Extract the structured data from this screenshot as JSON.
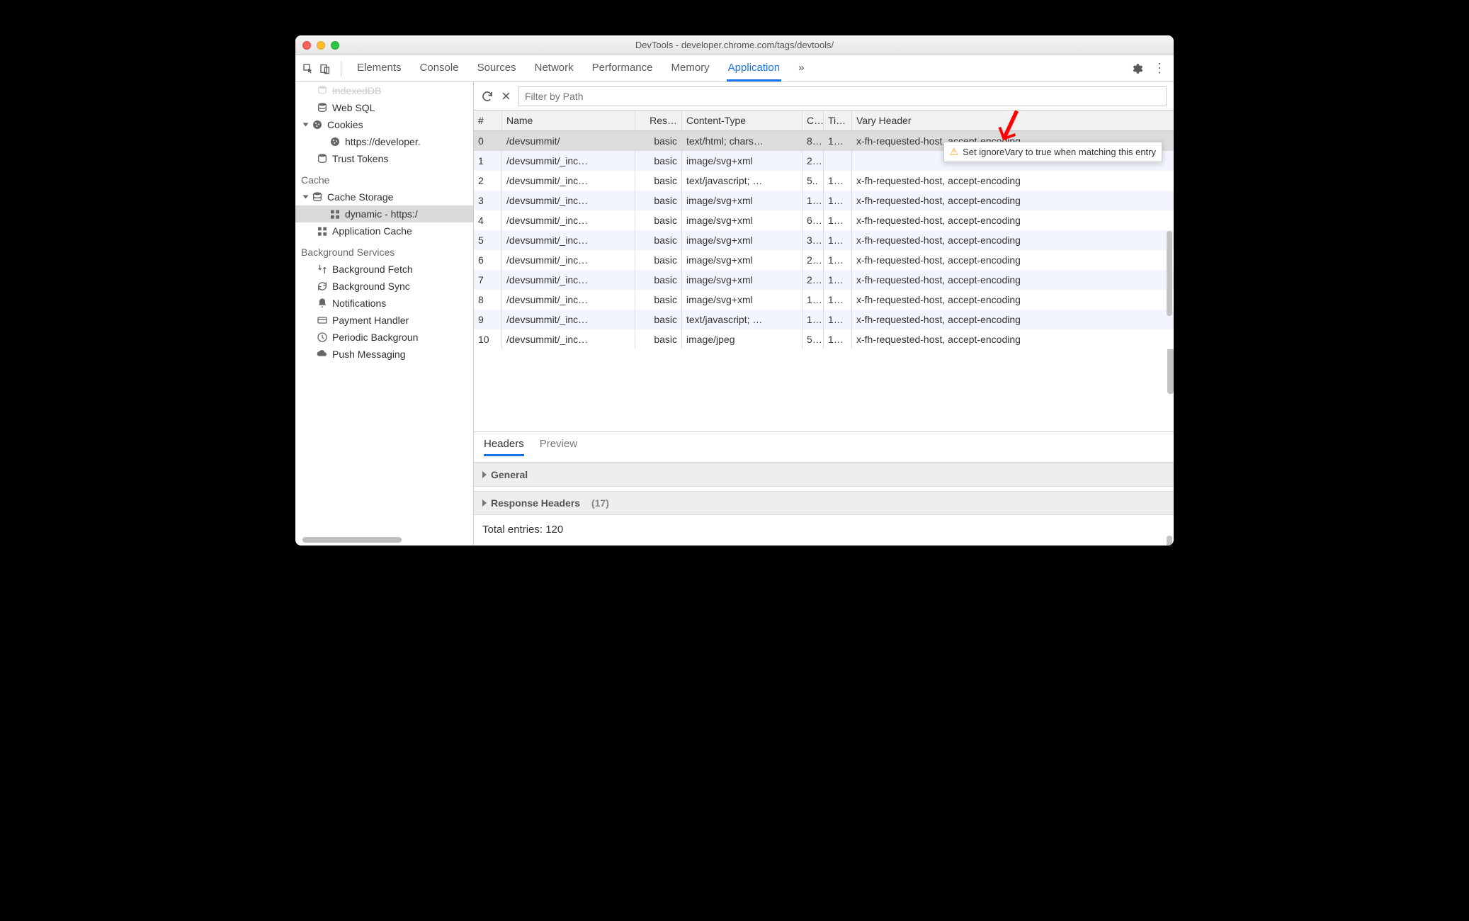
{
  "window_title": "DevTools - developer.chrome.com/tags/devtools/",
  "tabs": {
    "items": [
      "Elements",
      "Console",
      "Sources",
      "Network",
      "Performance",
      "Memory",
      "Application"
    ],
    "overflow": "»",
    "active": "Application"
  },
  "sidebar": {
    "top_item_obscured": "IndexedDB",
    "storage": {
      "websql": "Web SQL",
      "cookies": "Cookies",
      "cookie_entry": "https://developer.",
      "trust_tokens": "Trust Tokens"
    },
    "cache": {
      "section": "Cache",
      "cache_storage": "Cache Storage",
      "dynamic": "dynamic - https:/",
      "application_cache": "Application Cache"
    },
    "bgservices": {
      "section": "Background Services",
      "items": [
        "Background Fetch",
        "Background Sync",
        "Notifications",
        "Payment Handler",
        "Periodic Backgroun",
        "Push Messaging"
      ]
    }
  },
  "filter": {
    "placeholder": "Filter by Path"
  },
  "columns": [
    "#",
    "Name",
    "Res…",
    "Content-Type",
    "C..",
    "Ti…",
    "Vary Header"
  ],
  "rows": [
    {
      "idx": "0",
      "name": "/devsummit/",
      "res": "basic",
      "ct": "text/html; chars…",
      "cl": "8…",
      "tc": "1…",
      "vh": "x-fh-requested-host, accept-encoding",
      "selected": true
    },
    {
      "idx": "1",
      "name": "/devsummit/_inc…",
      "res": "basic",
      "ct": "image/svg+xml",
      "cl": "2…",
      "tc": "",
      "vh": ""
    },
    {
      "idx": "2",
      "name": "/devsummit/_inc…",
      "res": "basic",
      "ct": "text/javascript; …",
      "cl": "5..",
      "tc": "1…",
      "vh": "x-fh-requested-host, accept-encoding"
    },
    {
      "idx": "3",
      "name": "/devsummit/_inc…",
      "res": "basic",
      "ct": "image/svg+xml",
      "cl": "1…",
      "tc": "1…",
      "vh": "x-fh-requested-host, accept-encoding"
    },
    {
      "idx": "4",
      "name": "/devsummit/_inc…",
      "res": "basic",
      "ct": "image/svg+xml",
      "cl": "6…",
      "tc": "1…",
      "vh": "x-fh-requested-host, accept-encoding"
    },
    {
      "idx": "5",
      "name": "/devsummit/_inc…",
      "res": "basic",
      "ct": "image/svg+xml",
      "cl": "3…",
      "tc": "1…",
      "vh": "x-fh-requested-host, accept-encoding"
    },
    {
      "idx": "6",
      "name": "/devsummit/_inc…",
      "res": "basic",
      "ct": "image/svg+xml",
      "cl": "2…",
      "tc": "1…",
      "vh": "x-fh-requested-host, accept-encoding"
    },
    {
      "idx": "7",
      "name": "/devsummit/_inc…",
      "res": "basic",
      "ct": "image/svg+xml",
      "cl": "2…",
      "tc": "1…",
      "vh": "x-fh-requested-host, accept-encoding"
    },
    {
      "idx": "8",
      "name": "/devsummit/_inc…",
      "res": "basic",
      "ct": "image/svg+xml",
      "cl": "1…",
      "tc": "1…",
      "vh": "x-fh-requested-host, accept-encoding"
    },
    {
      "idx": "9",
      "name": "/devsummit/_inc…",
      "res": "basic",
      "ct": "text/javascript; …",
      "cl": "1…",
      "tc": "1…",
      "vh": "x-fh-requested-host, accept-encoding"
    },
    {
      "idx": "10",
      "name": "/devsummit/_inc…",
      "res": "basic",
      "ct": "image/jpeg",
      "cl": "5…",
      "tc": "1…",
      "vh": "x-fh-requested-host, accept-encoding"
    }
  ],
  "tooltip": "Set ignoreVary to true when matching this entry",
  "detail_tabs": {
    "headers": "Headers",
    "preview": "Preview"
  },
  "sections": {
    "general": "General",
    "response_headers": "Response Headers",
    "response_headers_count": "(17)"
  },
  "total": "Total entries: 120"
}
